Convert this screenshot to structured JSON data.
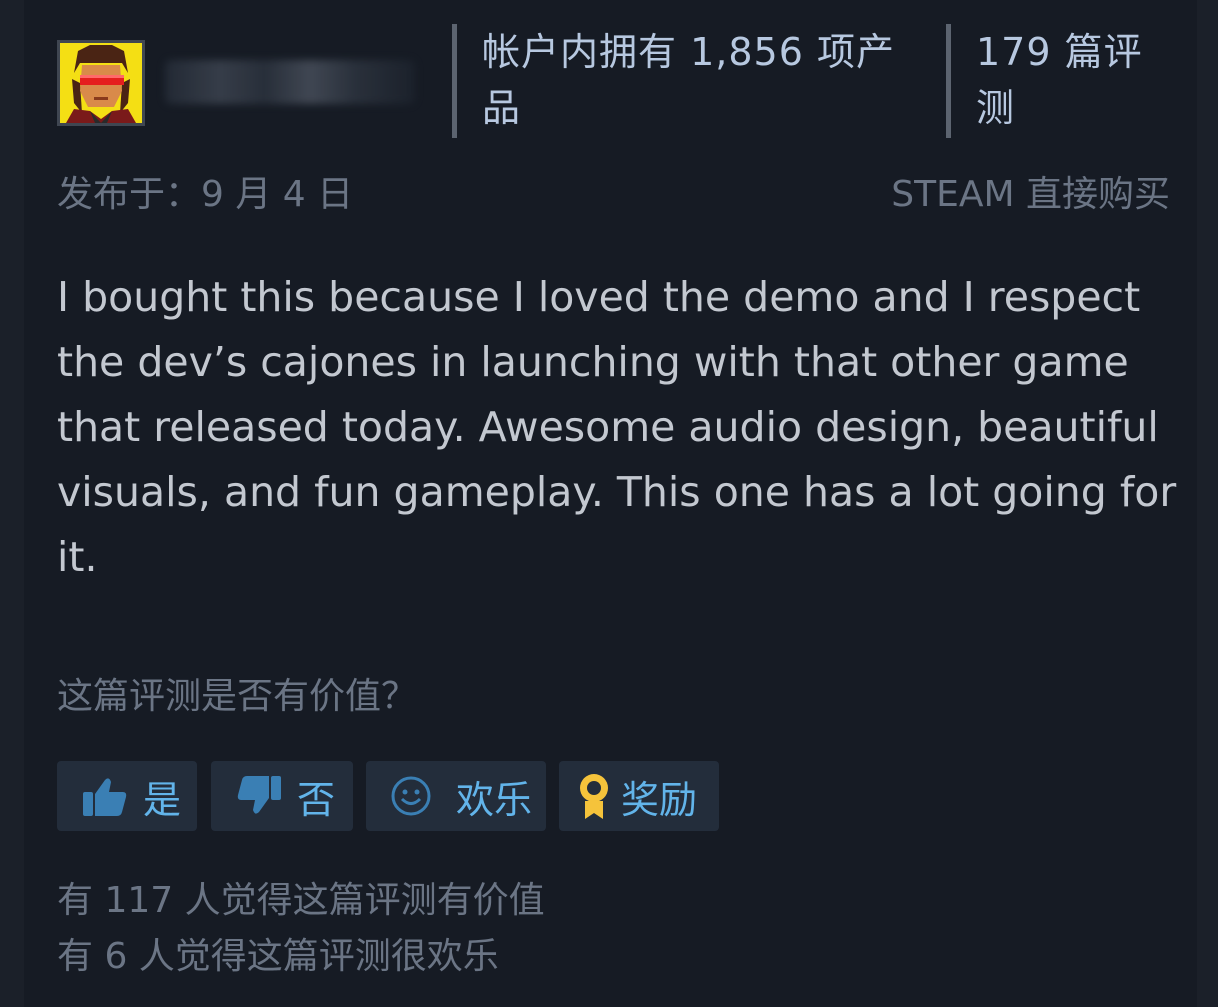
{
  "reviewer": {
    "products_owned": "帐户内拥有 1,856 项产品",
    "review_count": "179 篇评测"
  },
  "meta": {
    "posted": "发布于：9 月 4 日",
    "source": "STEAM 直接购买"
  },
  "review": {
    "text": "I bought this because I loved the demo and I respect the dev’s cajones in launching with that other game that released today. Awesome audio design, beautiful visuals, and fun gameplay. This one has a lot going for it."
  },
  "feedback": {
    "question": "这篇评测是否有价值？",
    "yes_label": "是",
    "no_label": "否",
    "funny_label": "欢乐",
    "award_label": "奖励",
    "helpful_count_text": "有 117 人觉得这篇评测有价值",
    "funny_count_text": "有 6 人觉得这篇评测很欢乐"
  },
  "colors": {
    "background": "#161b24",
    "accent": "#62b4ea",
    "muted_text": "#6b7585",
    "body_text": "#c3c8d0",
    "award_gold": "#f5c33b"
  },
  "icons": {
    "avatar": "pixel-art-avatar",
    "yes": "thumbs-up-icon",
    "no": "thumbs-down-icon",
    "funny": "smiley-face-icon",
    "award": "award-medal-icon"
  }
}
